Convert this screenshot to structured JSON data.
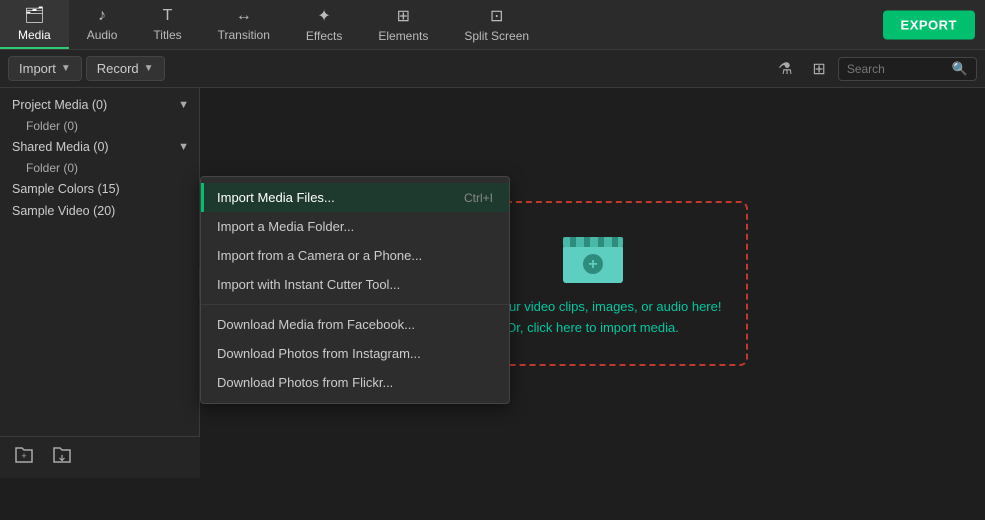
{
  "nav": {
    "items": [
      {
        "id": "media",
        "label": "Media",
        "icon": "🖼",
        "active": true
      },
      {
        "id": "audio",
        "label": "Audio",
        "icon": "♪"
      },
      {
        "id": "titles",
        "label": "Titles",
        "icon": "T"
      },
      {
        "id": "transition",
        "label": "Transition",
        "icon": "↔"
      },
      {
        "id": "effects",
        "label": "Effects",
        "icon": "✦"
      },
      {
        "id": "elements",
        "label": "Elements",
        "icon": "⊞"
      },
      {
        "id": "split_screen",
        "label": "Split Screen",
        "icon": "⊡"
      }
    ],
    "export_label": "EXPORT"
  },
  "toolbar": {
    "import_label": "Import",
    "record_label": "Record",
    "search_placeholder": "Search"
  },
  "sidebar": {
    "items": [
      {
        "label": "Project Media (0)",
        "has_chevron": true,
        "sub": [
          {
            "label": "Folder (0)"
          }
        ]
      },
      {
        "label": "Shared Media (0)",
        "has_chevron": true,
        "sub": [
          {
            "label": "Folder (0)"
          }
        ]
      },
      {
        "label": "Sample Colors (15)",
        "has_chevron": false
      },
      {
        "label": "Sample Video (20)",
        "has_chevron": false
      }
    ]
  },
  "dropdown": {
    "items": [
      {
        "label": "Import Media Files...",
        "shortcut": "Ctrl+I",
        "highlighted": true
      },
      {
        "label": "Import a Media Folder..."
      },
      {
        "label": "Import from a Camera or a Phone..."
      },
      {
        "label": "Import with Instant Cutter Tool..."
      },
      {
        "divider": true
      },
      {
        "label": "Download Media from Facebook..."
      },
      {
        "label": "Download Photos from Instagram..."
      },
      {
        "label": "Download Photos from Flickr..."
      }
    ]
  },
  "dropzone": {
    "line1": "Drop your video clips, images, or audio here!",
    "line2": "Or, click here to import media."
  },
  "bottom": {
    "add_folder_icon": "📁",
    "import_icon": "📂"
  }
}
